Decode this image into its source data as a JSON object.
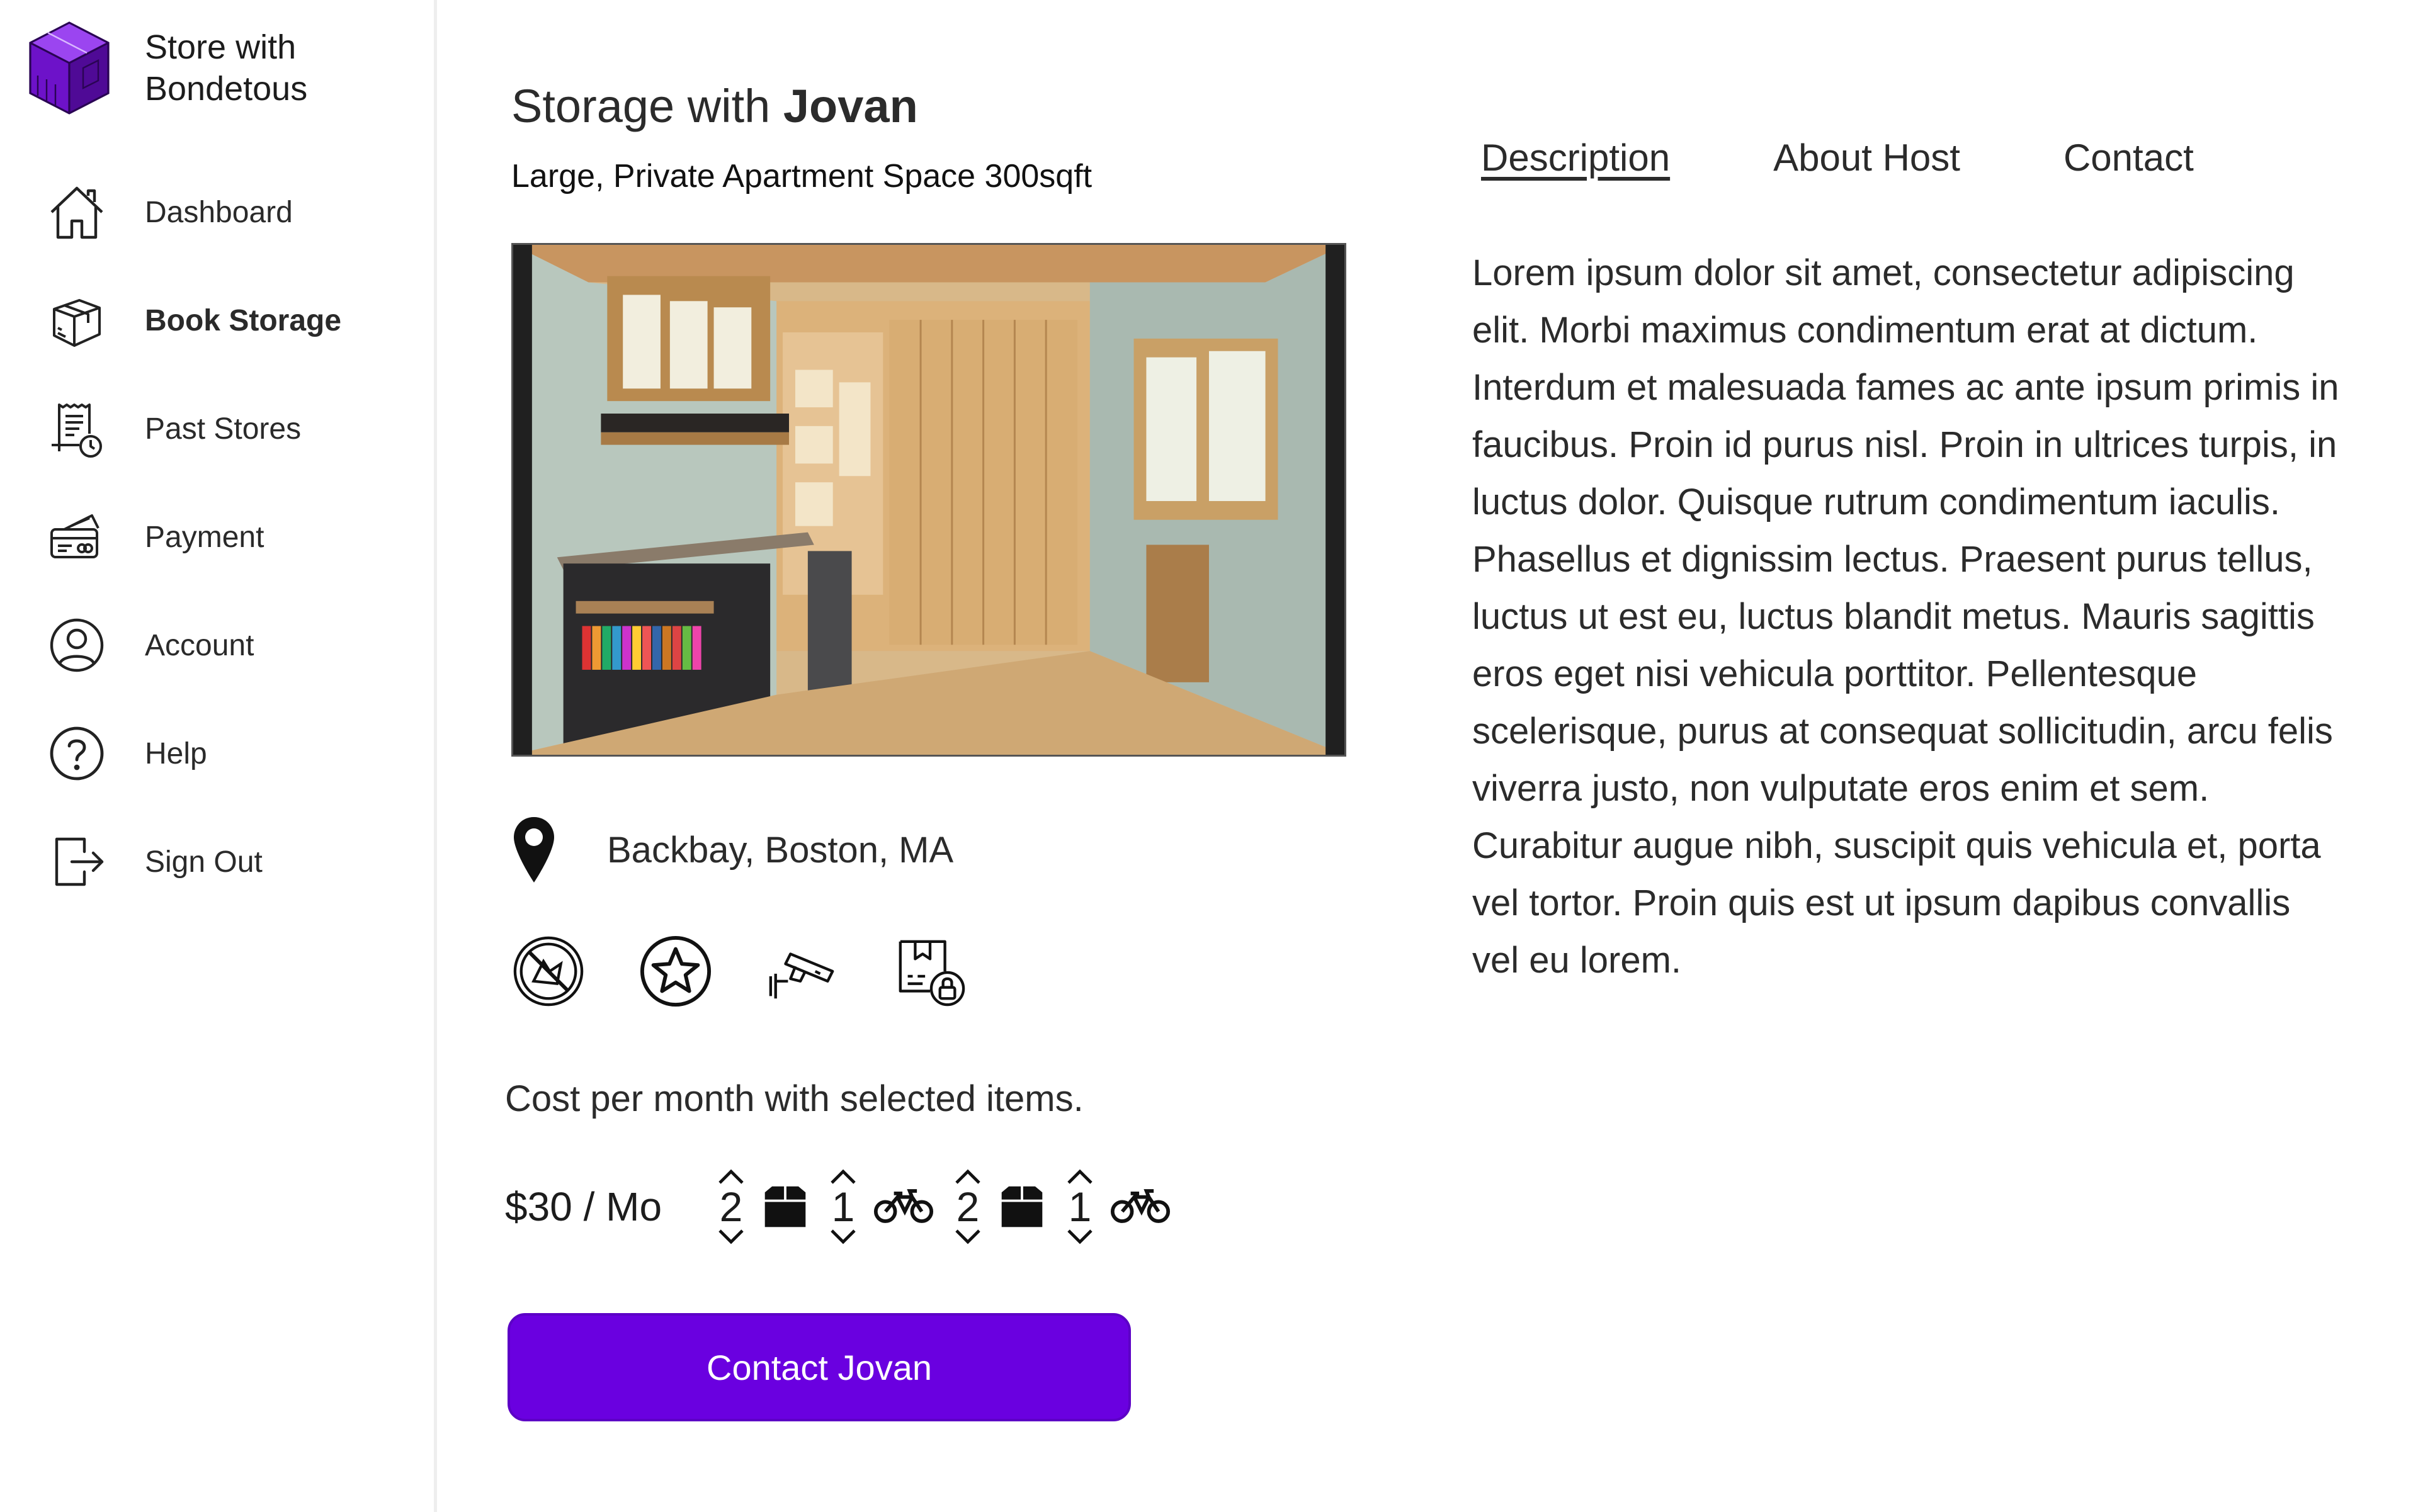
{
  "brand": {
    "name": "Store with Bondetous",
    "logo": "isometric-box-logo"
  },
  "sidebar": {
    "items": [
      {
        "label": "Dashboard",
        "icon": "home-icon",
        "active": false
      },
      {
        "label": "Book Storage",
        "icon": "box-icon",
        "active": true
      },
      {
        "label": "Past Stores",
        "icon": "receipt-clock-icon",
        "active": false
      },
      {
        "label": "Payment",
        "icon": "credit-card-icon",
        "active": false
      },
      {
        "label": "Account",
        "icon": "user-circle-icon",
        "active": false
      },
      {
        "label": "Help",
        "icon": "question-icon",
        "active": false
      },
      {
        "label": "Sign Out",
        "icon": "sign-out-icon",
        "active": false
      }
    ]
  },
  "listing": {
    "title_prefix": "Storage with ",
    "host_name": "Jovan",
    "subtitle": "Large, Private Apartment Space 300sqft",
    "location": "Backbay, Boston, MA",
    "amenities": [
      "no-pets-icon",
      "star-icon",
      "security-camera-icon",
      "secure-package-icon"
    ],
    "cost_caption": "Cost per month with selected items.",
    "price": "$30 / Mo",
    "items": [
      {
        "count": "2",
        "icon": "box-icon"
      },
      {
        "count": "1",
        "icon": "bicycle-icon"
      },
      {
        "count": "2",
        "icon": "box-icon"
      },
      {
        "count": "1",
        "icon": "bicycle-icon"
      }
    ],
    "contact_button": "Contact Jovan"
  },
  "tabs": [
    {
      "label": "Description",
      "active": true
    },
    {
      "label": "About Host",
      "active": false
    },
    {
      "label": "Contact",
      "active": false
    }
  ],
  "description": "Lorem ipsum dolor sit amet, consectetur adipiscing elit. Morbi maximus condimentum erat at dictum. Interdum et malesuada fames ac ante ipsum primis in faucibus. Proin id purus nisl. Proin in ultrices turpis, in luctus dolor. Quisque rutrum condimentum iaculis. Phasellus et dignissim lectus. Praesent purus tellus, luctus ut est eu, luctus blandit metus. Mauris sagittis eros eget nisi vehicula porttitor. Pellentesque scelerisque, purus at consequat sollicitudin, arcu felis viverra justo, non vulputate eros enim et sem. Curabitur augue nibh, suscipit quis vehicula et, porta vel tortor. Proin quis est ut ipsum dapibus convallis vel eu lorem.",
  "colors": {
    "accent": "#6a00e0",
    "logo": "#7b1fd6",
    "text": "#2b2b2b"
  }
}
